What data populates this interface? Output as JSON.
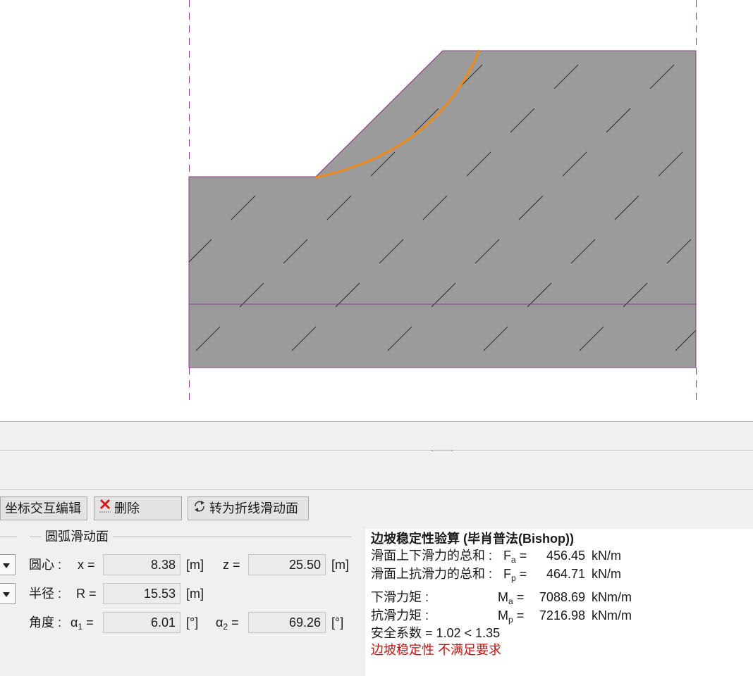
{
  "colors": {
    "soil_fill": "#9b9b9b",
    "soil_outline": "#8a3a8a",
    "slip_surface": "#f08a18",
    "warning_text": "#c81010",
    "panel_bg": "#f0f0f0"
  },
  "toolbar": {
    "edit_label": "坐标交互编辑",
    "delete_label": "删除",
    "convert_label": "转为折线滑动面"
  },
  "group": {
    "title": "圆弧滑动面"
  },
  "center": {
    "label": "圆心 :",
    "x_label": "x =",
    "x_value": "8.38",
    "x_unit": "[m]",
    "z_label": "z =",
    "z_value": "25.50",
    "z_unit": "[m]"
  },
  "radius": {
    "label": "半径 :",
    "r_label": "R =",
    "r_value": "15.53",
    "r_unit": "[m]"
  },
  "angle": {
    "label": "角度 :",
    "a1_sym": "α",
    "a1_sub": "1",
    "a1_eq": "=",
    "a1_value": "6.01",
    "a1_unit": "[°]",
    "a2_sym": "α",
    "a2_sub": "2",
    "a2_eq": "=",
    "a2_value": "69.26",
    "a2_unit": "[°]"
  },
  "results": {
    "title": "边坡稳定性验算 (毕肖普法(Bishop))",
    "fa_label": "滑面上下滑力的总和 :",
    "fa_sym": "F",
    "fa_sub": "a",
    "fa_eq": "=",
    "fa_value": "456.45",
    "fa_unit": "kN/m",
    "fp_label": "滑面上抗滑力的总和 :",
    "fp_sym": "F",
    "fp_sub": "p",
    "fp_eq": "=",
    "fp_value": "464.71",
    "fp_unit": "kN/m",
    "ma_label": "下滑力矩 :",
    "ma_sym": "M",
    "ma_sub": "a",
    "ma_eq": "=",
    "ma_value": "7088.69",
    "ma_unit": "kNm/m",
    "mp_label": "抗滑力矩 :",
    "mp_sym": "M",
    "mp_sub": "p",
    "mp_eq": "=",
    "mp_value": "7216.98",
    "mp_unit": "kNm/m",
    "fs_line": "安全系数 = 1.02 < 1.35",
    "verdict": "边坡稳定性 不满足要求"
  }
}
